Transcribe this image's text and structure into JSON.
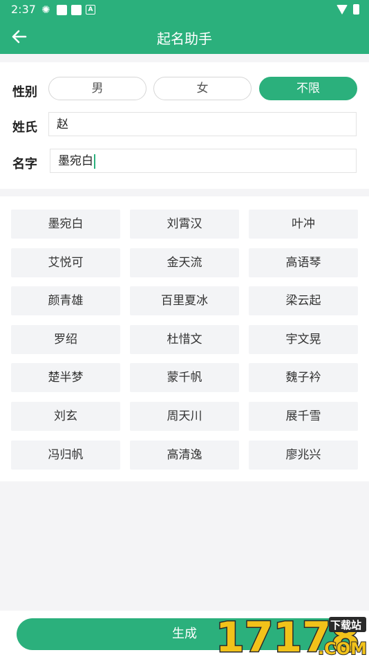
{
  "status_bar": {
    "time": "2:37"
  },
  "app_bar": {
    "title": "起名助手"
  },
  "form": {
    "gender_label": "性别",
    "gender_options": [
      "男",
      "女",
      "不限"
    ],
    "gender_selected": "不限",
    "surname_label": "姓氏",
    "surname_value": "赵",
    "name_label": "名字",
    "name_value": "墨宛白"
  },
  "names": [
    "墨宛白",
    "刘霄汉",
    "叶冲",
    "艾悦可",
    "金天流",
    "高语琴",
    "颜青雄",
    "百里夏冰",
    "梁云起",
    "罗绍",
    "杜惜文",
    "宇文晃",
    "楚半梦",
    "蒙千帆",
    "魏子衿",
    "刘玄",
    "周天川",
    "展千雪",
    "冯归帆",
    "高清逸",
    "廖兆兴"
  ],
  "generate_label": "生成",
  "watermark": {
    "number": "17178",
    "tag": "下载站",
    "domain": ".COM"
  },
  "colors": {
    "accent": "#2bb07c",
    "chip": "#f3f4f6"
  }
}
